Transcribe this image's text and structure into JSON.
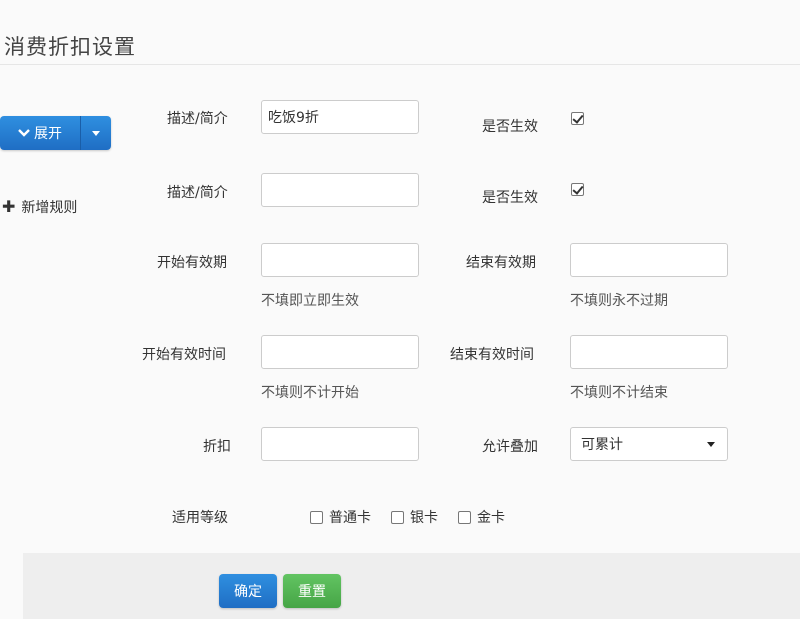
{
  "page": {
    "title": "消费折扣设置"
  },
  "sidebar": {
    "expand_label": "展开",
    "add_rule_label": "新增规则"
  },
  "form": {
    "row1": {
      "desc_label": "描述/简介",
      "desc_value": "吃饭9折",
      "active_label": "是否生效",
      "active_checked": true
    },
    "row2": {
      "desc_label": "描述/简介",
      "desc_value": "",
      "active_label": "是否生效",
      "active_checked": true
    },
    "start_date_label": "开始有效期",
    "start_date_hint": "不填即立即生效",
    "end_date_label": "结束有效期",
    "end_date_hint": "不填则永不过期",
    "start_time_label": "开始有效时间",
    "start_time_hint": "不填则不计开始",
    "end_time_label": "结束有效时间",
    "end_time_hint": "不填则不计结束",
    "discount_label": "折扣",
    "stack_label": "允许叠加",
    "stack_value": "可累计",
    "levels_label": "适用等级",
    "levels": [
      {
        "label": "普通卡",
        "checked": false
      },
      {
        "label": "银卡",
        "checked": false
      },
      {
        "label": "金卡",
        "checked": false
      }
    ]
  },
  "actions": {
    "confirm_label": "确定",
    "reset_label": "重置"
  },
  "colors": {
    "primary": "#2a82d6",
    "success": "#52b052"
  }
}
